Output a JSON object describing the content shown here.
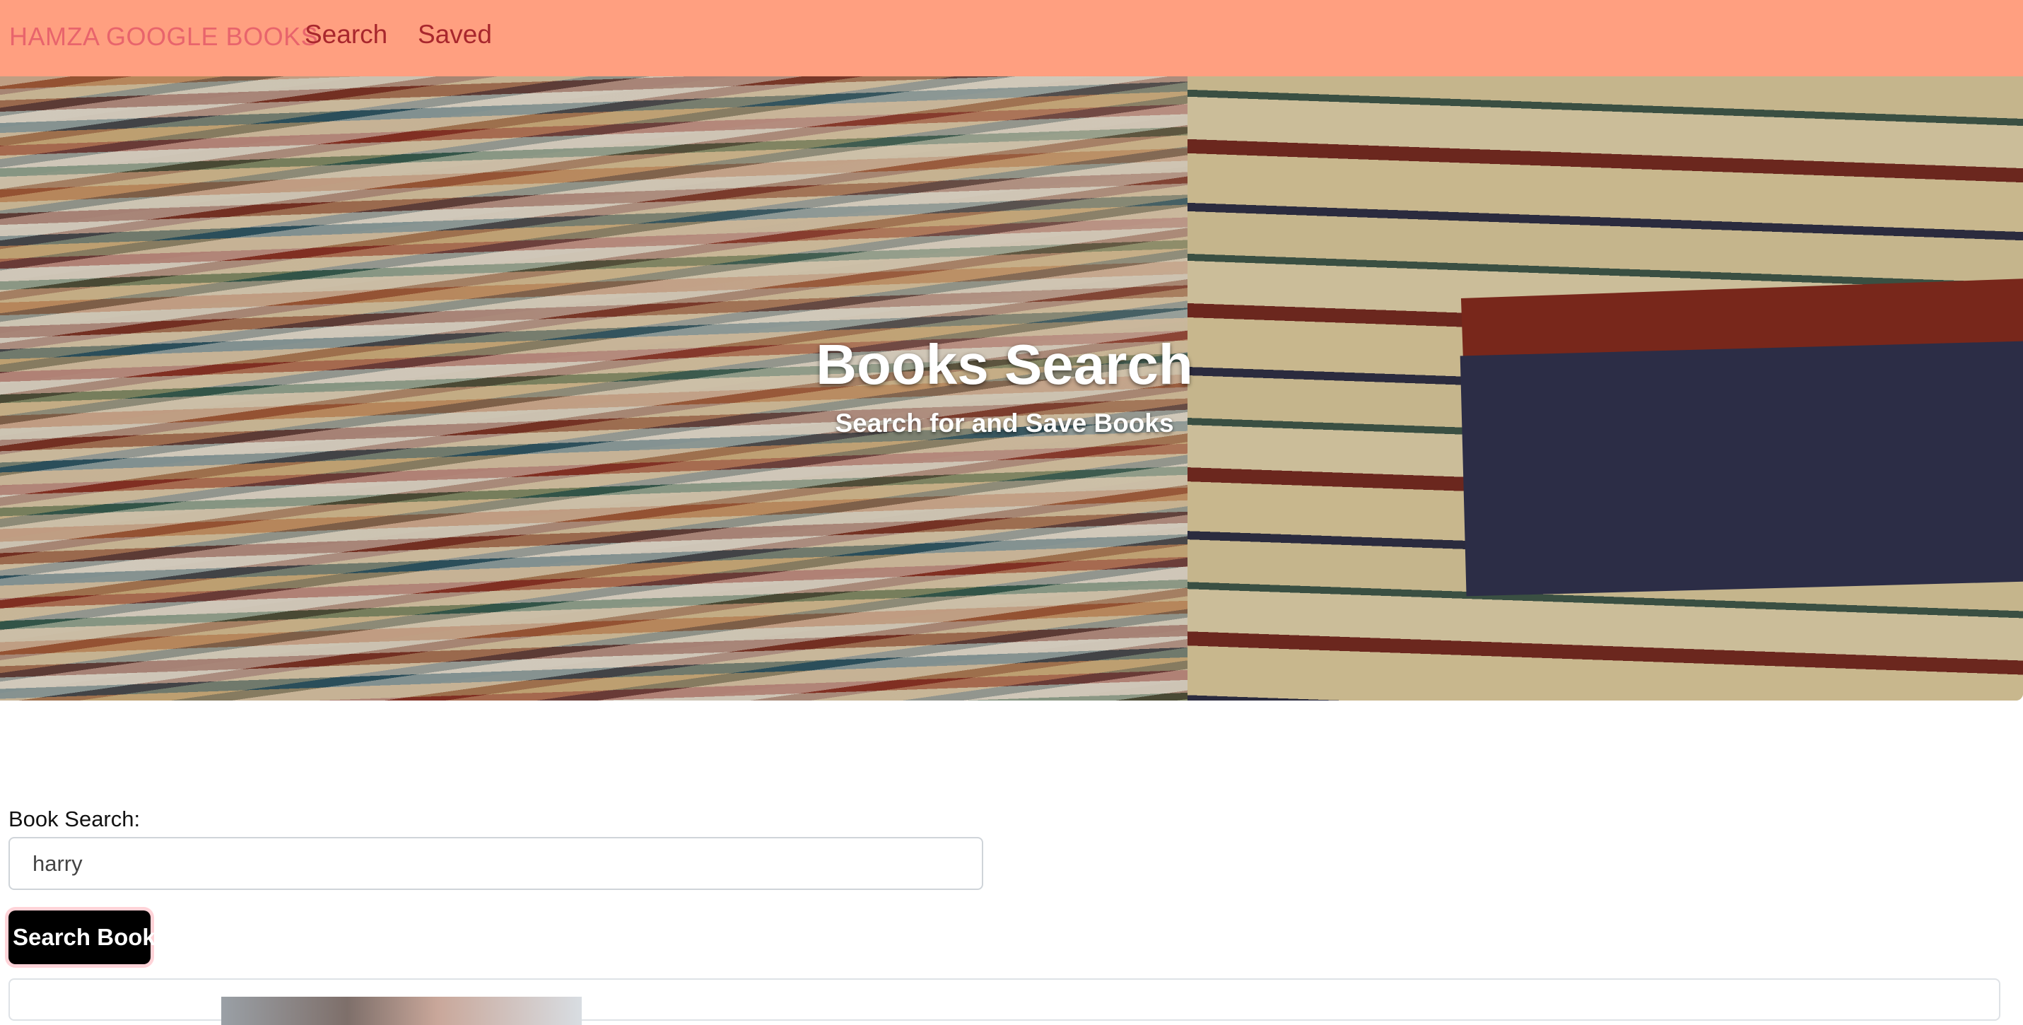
{
  "navbar": {
    "brand": "HAMZA GOOGLE BOOKS",
    "links": [
      {
        "label": "Search"
      },
      {
        "label": "Saved"
      }
    ]
  },
  "hero": {
    "title": "Books Search",
    "subtitle": "Search for and Save Books"
  },
  "search_form": {
    "label": "Book Search:",
    "input_value": "harry",
    "button_label": "Search Book"
  },
  "colors": {
    "navbar_bg": "#ff9f80",
    "brand_text": "#e8646c",
    "nav_link_text": "#a8272d",
    "button_bg": "#000000"
  }
}
